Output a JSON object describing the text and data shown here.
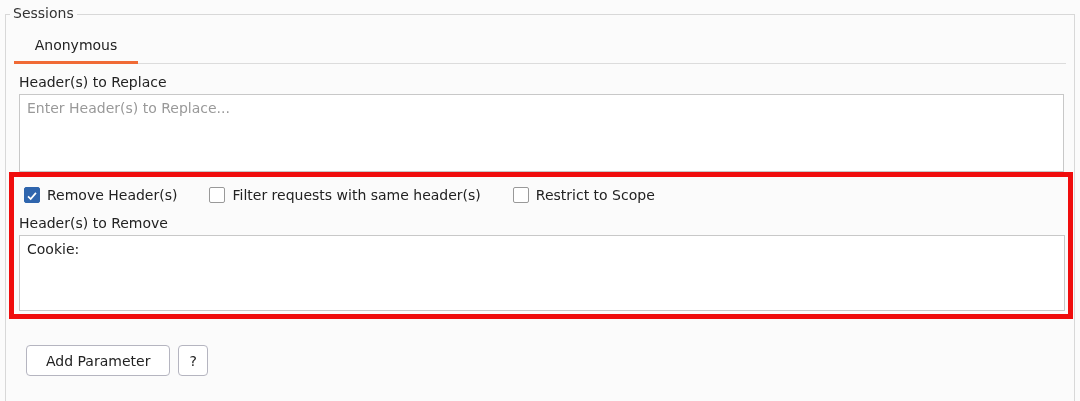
{
  "group": {
    "title": "Sessions"
  },
  "tabs": [
    {
      "label": "Anonymous",
      "selected": true
    }
  ],
  "replace": {
    "label": "Header(s) to Replace",
    "placeholder": "Enter Header(s) to Replace..."
  },
  "options": [
    {
      "label": "Remove Header(s)",
      "checked": true
    },
    {
      "label": "Filter requests with same header(s)",
      "checked": false
    },
    {
      "label": "Restrict to Scope",
      "checked": false
    }
  ],
  "remove": {
    "label": "Header(s) to Remove",
    "value": "Cookie:"
  },
  "highlight": {
    "on": true
  },
  "buttons": [
    {
      "label": "Add Parameter"
    },
    {
      "label": "?"
    }
  ]
}
